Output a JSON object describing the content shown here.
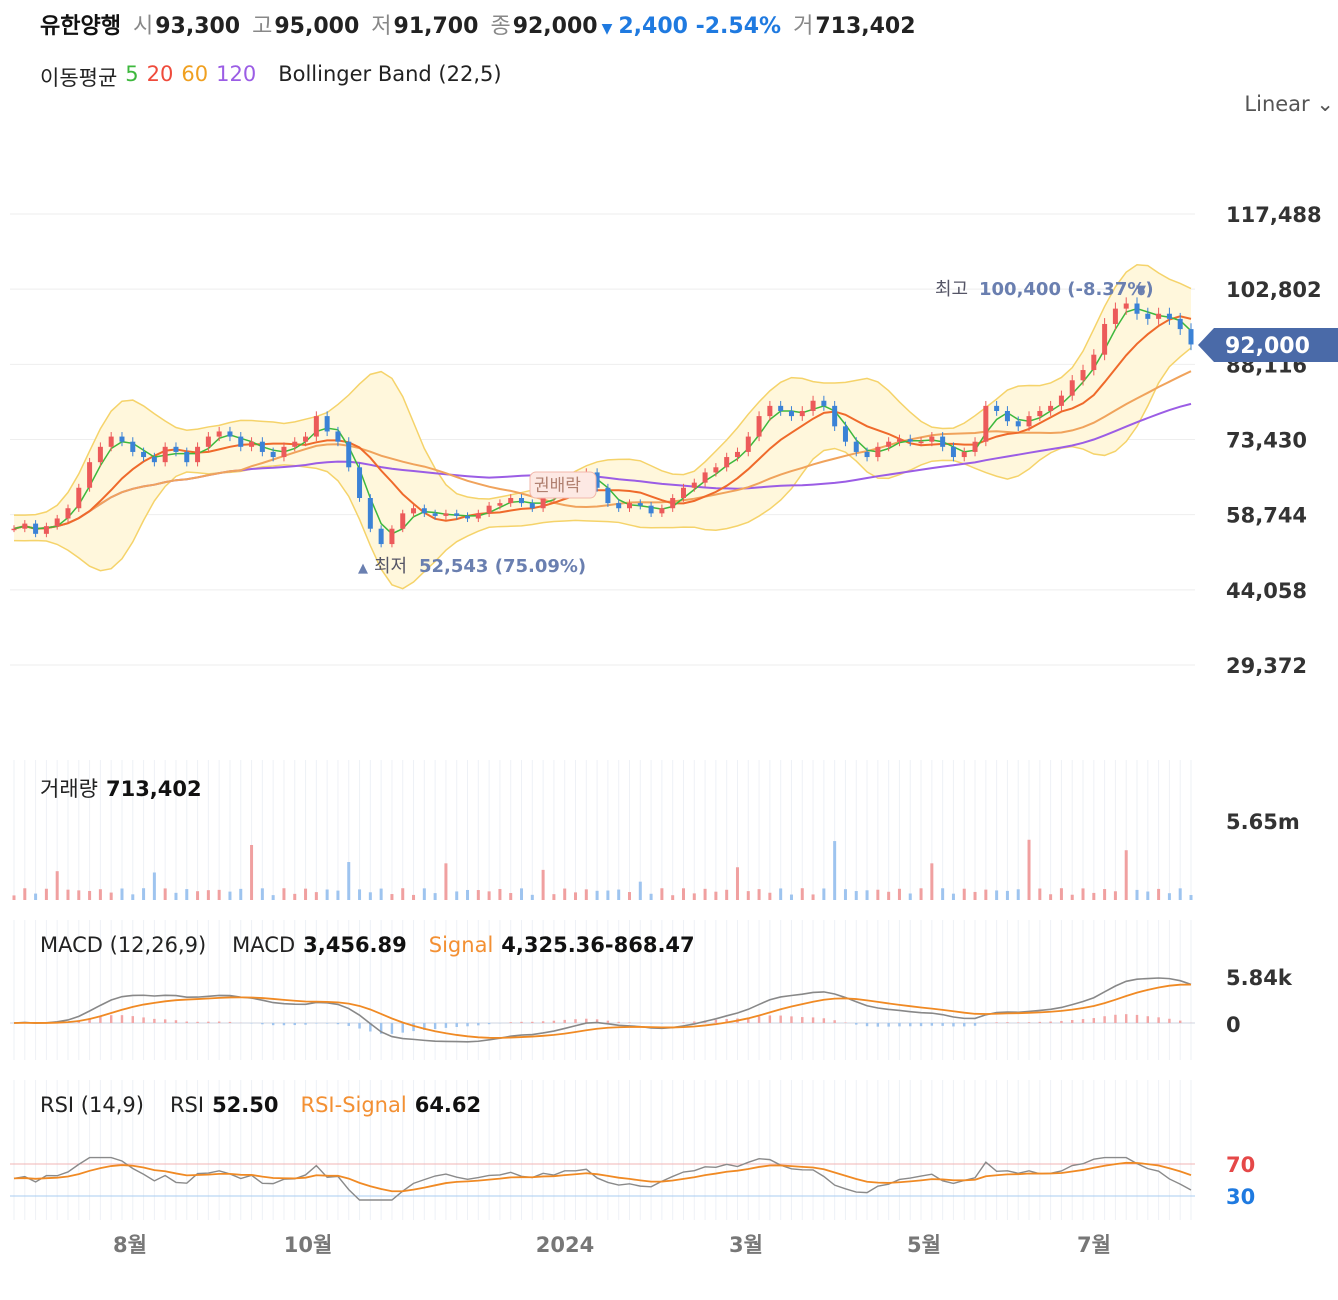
{
  "header": {
    "name": "유한양행",
    "open_label": "시",
    "open": "93,300",
    "high_label": "고",
    "high": "95,000",
    "low_label": "저",
    "low": "91,700",
    "close_label": "종",
    "close": "92,000",
    "down_arrow": "▼",
    "change": "2,400 -2.54%",
    "volume_label": "거",
    "volume": "713,402"
  },
  "ma_legend": {
    "label": "이동평균",
    "p5": "5",
    "p20": "20",
    "p60": "60",
    "p120": "120",
    "bollinger": "Bollinger Band (22,5)"
  },
  "scale_mode": "Linear",
  "colors": {
    "up": "#ec5a5a",
    "down": "#3b82d6",
    "ma5": "#3db83d",
    "ma20": "#ef6a2b",
    "ma60": "#f0a35c",
    "ma120": "#9b5de5",
    "band_fill": "#fff7dc",
    "band_line": "#f5d36a",
    "macd_line": "#888888",
    "signal_line": "#f08a24",
    "price_tag": "#4a6aa8"
  },
  "price_axis": {
    "ticks": [
      "117,488",
      "102,802",
      "88,116",
      "73,430",
      "58,744",
      "44,058",
      "29,372"
    ],
    "values": [
      117488,
      102802,
      88116,
      73430,
      58744,
      44058,
      29372
    ],
    "current": "92,000"
  },
  "annotations": {
    "high_text": "최고",
    "high_value": "100,400 (-8.37%)",
    "high_marker": "▼",
    "low_marker": "▲",
    "low_text": "최저",
    "low_value": "52,543 (75.09%)",
    "event": "권배락"
  },
  "volume": {
    "title": "거래량",
    "value": "713,402",
    "tick": "5.65m"
  },
  "macd": {
    "title": "MACD (12,26,9)",
    "macd_label": "MACD",
    "macd_value": "3,456.89",
    "signal_label": "Signal",
    "signal_value": "4,325.36-868.47",
    "ticks": [
      "5.84k",
      "0"
    ]
  },
  "rsi": {
    "title": "RSI (14,9)",
    "rsi_label": "RSI",
    "rsi_value": "52.50",
    "signal_label": "RSI-Signal",
    "signal_value": "64.62",
    "upper": "70",
    "lower": "30"
  },
  "time_axis": [
    "8월",
    "10월",
    "2024",
    "3월",
    "5월",
    "7월"
  ],
  "chart_data": {
    "type": "candlestick",
    "x_ticks": [
      "8월",
      "10월",
      "2024",
      "3월",
      "5월",
      "7월"
    ],
    "close_series": [
      56000,
      57000,
      55000,
      56500,
      58000,
      60000,
      64000,
      69000,
      72000,
      74000,
      73000,
      71000,
      70000,
      69000,
      72000,
      71000,
      69000,
      72000,
      74000,
      75000,
      74000,
      72000,
      73000,
      71000,
      70000,
      72000,
      73000,
      74000,
      78000,
      75000,
      73000,
      68000,
      62000,
      56000,
      53000,
      56000,
      59000,
      60000,
      59000,
      58500,
      59000,
      58500,
      58000,
      59000,
      60500,
      61000,
      62000,
      61000,
      60000,
      62000,
      63000,
      65000,
      66000,
      67000,
      64000,
      61000,
      60000,
      61000,
      60500,
      59000,
      60000,
      62000,
      64000,
      65000,
      67000,
      68000,
      70000,
      71000,
      74000,
      78000,
      80000,
      79000,
      78000,
      79000,
      81000,
      80000,
      76000,
      73000,
      71000,
      70000,
      72000,
      73000,
      73500,
      73000,
      73000,
      74000,
      72000,
      70000,
      71000,
      73000,
      80000,
      79000,
      77000,
      76000,
      78000,
      79000,
      80000,
      82000,
      85000,
      87000,
      90000,
      96000,
      99000,
      100000,
      98000,
      97000,
      98000,
      97000,
      95000,
      92000
    ],
    "volume_peaks_m": [
      2.2,
      2.1,
      4.2,
      2.9,
      2.8,
      2.3,
      1.4,
      2.5,
      4.5,
      2.8,
      4.6,
      3.8
    ],
    "macd_range": [
      -3000,
      5840
    ],
    "rsi_levels": [
      30,
      70
    ],
    "extremes": {
      "high": 100400,
      "low": 52543
    }
  }
}
